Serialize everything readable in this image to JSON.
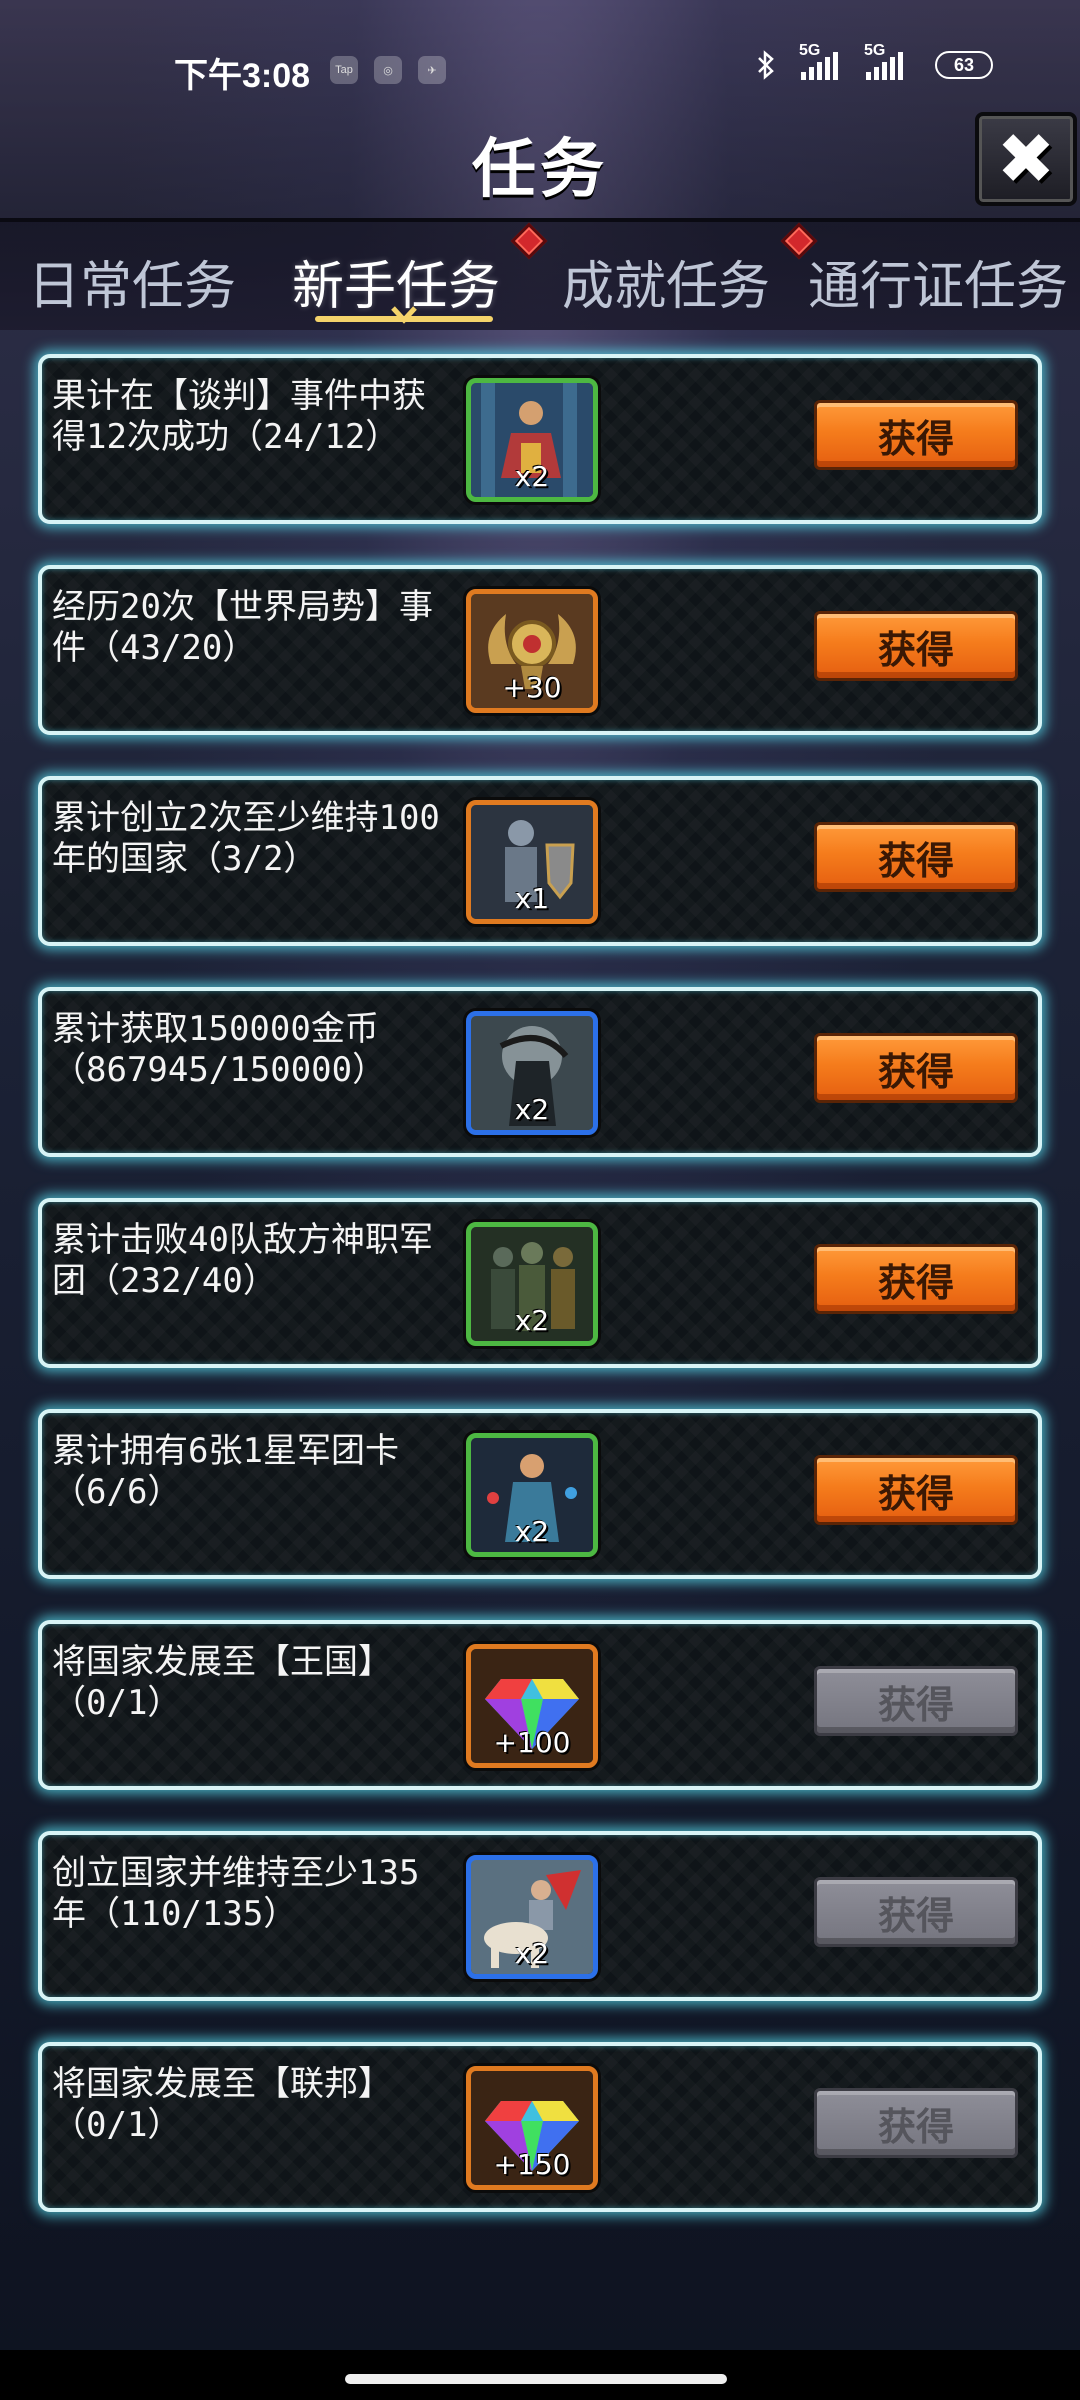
{
  "status_bar": {
    "time": "下午3:08",
    "left_icons": [
      "Tap",
      "◎",
      "✈"
    ],
    "signal1": "5G",
    "signal2": "5G",
    "battery": "63"
  },
  "header": {
    "title": "任务",
    "close_label": "✖"
  },
  "tabs": [
    {
      "label": "日常任务",
      "active": false,
      "badge": false
    },
    {
      "label": "新手任务",
      "active": true,
      "badge": true
    },
    {
      "label": "成就任务",
      "active": false,
      "badge": true
    },
    {
      "label": "通行证任务",
      "active": false,
      "badge": false
    }
  ],
  "tasks": [
    {
      "text": "果计在【谈判】事件中获得12次成功（24/12）",
      "reward_qty": "x2",
      "reward_frame": "green",
      "reward_icon": "hero-card-icon",
      "button": "获得",
      "enabled": true
    },
    {
      "text": "经历20次【世界局势】事件（43/20）",
      "reward_qty": "+30",
      "reward_frame": "orange",
      "reward_icon": "laurel-medal-icon",
      "button": "获得",
      "enabled": true
    },
    {
      "text": "累计创立2次至少维持100年的国家（3/2）",
      "reward_qty": "x1",
      "reward_frame": "orange",
      "reward_icon": "knight-card-icon",
      "button": "获得",
      "enabled": true
    },
    {
      "text": "累计获取150000金币（867945/150000）",
      "reward_qty": "x2",
      "reward_frame": "blue",
      "reward_icon": "reaper-card-icon",
      "button": "获得",
      "enabled": true
    },
    {
      "text": "累计击败40队敌方神职军团（232/40）",
      "reward_qty": "x2",
      "reward_frame": "green",
      "reward_icon": "soldiers-card-icon",
      "button": "获得",
      "enabled": true
    },
    {
      "text": "累计拥有6张1星军团卡（6/6）",
      "reward_qty": "x2",
      "reward_frame": "green",
      "reward_icon": "mage-card-icon",
      "button": "获得",
      "enabled": true
    },
    {
      "text": "将国家发展至【王国】（0/1）",
      "reward_qty": "+100",
      "reward_frame": "orange",
      "reward_icon": "rainbow-gem-icon",
      "button": "获得",
      "enabled": false
    },
    {
      "text": "创立国家并维持至少135年（110/135）",
      "reward_qty": "x2",
      "reward_frame": "blue",
      "reward_icon": "cavalry-card-icon",
      "button": "获得",
      "enabled": false
    },
    {
      "text": "将国家发展至【联邦】（0/1）",
      "reward_qty": "+150",
      "reward_frame": "orange",
      "reward_icon": "rainbow-gem-icon",
      "button": "获得",
      "enabled": false
    }
  ],
  "colors": {
    "card_glow": "#56d6e8",
    "button_active": "#f57c1c",
    "button_disabled": "#7f7f88",
    "tab_underline": "#f4d36b",
    "badge": "#d2282c"
  }
}
